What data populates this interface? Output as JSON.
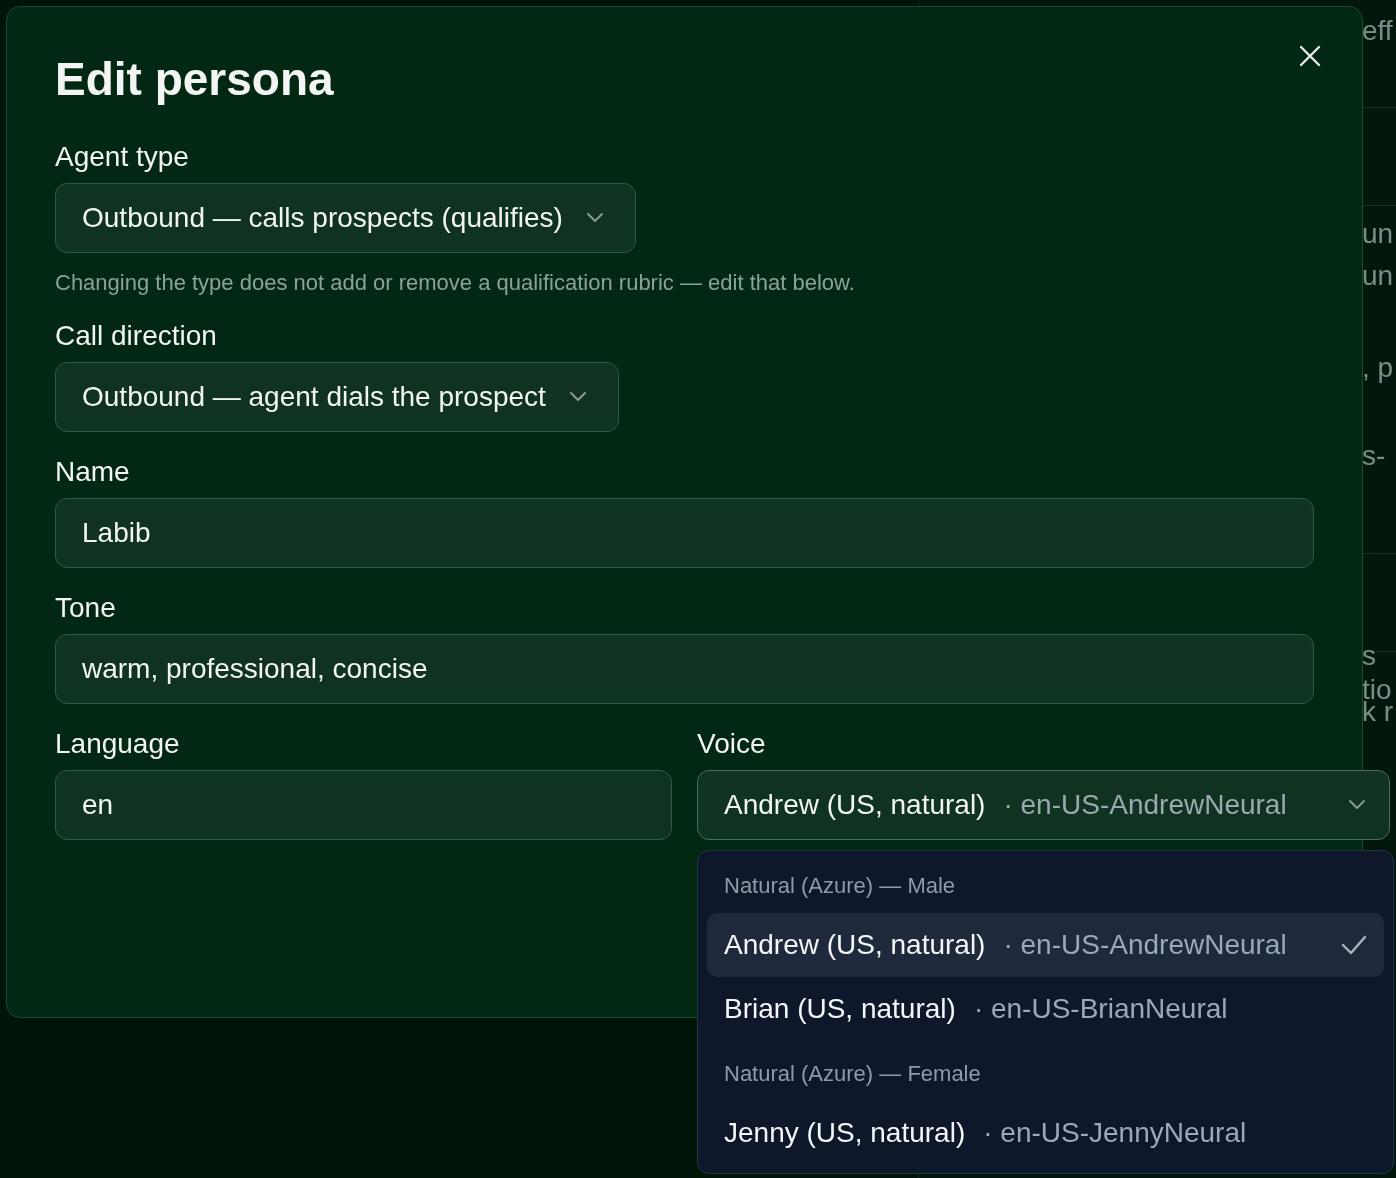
{
  "background_fragments": [
    {
      "text": "eff"
    },
    {
      "text": "un"
    },
    {
      "text": "un"
    },
    {
      "text": ", p"
    },
    {
      "text": "s-"
    },
    {
      "text": "s"
    },
    {
      "text": "tio"
    },
    {
      "text": "k r"
    }
  ],
  "dialog": {
    "title": "Edit persona",
    "fields": [
      {
        "kind": "select",
        "label": "Agent type",
        "value": "Outbound — calls prospects (qualifies)",
        "help": "Changing the type does not add or remove a qualification rubric — edit that below."
      },
      {
        "kind": "select",
        "label": "Call direction",
        "value": "Outbound — agent dials the prospect"
      },
      {
        "kind": "text",
        "label": "Name",
        "value": "Labib"
      },
      {
        "kind": "text",
        "label": "Tone",
        "value": "warm, professional, concise"
      }
    ],
    "row": [
      {
        "kind": "text",
        "label": "Language",
        "value": "en"
      },
      {
        "kind": "select",
        "label": "Voice",
        "value": "Andrew (US, natural)",
        "detail": "· en-US-AndrewNeural",
        "expanded": true
      }
    ]
  },
  "voice_menu": {
    "groups": [
      {
        "heading": "Natural (Azure) — Male",
        "options": [
          {
            "name": "Andrew (US, natural)",
            "detail": "· en-US-AndrewNeural",
            "selected": true
          },
          {
            "name": "Brian (US, natural)",
            "detail": "· en-US-BrianNeural",
            "selected": false
          }
        ]
      },
      {
        "heading": "Natural (Azure) — Female",
        "options": [
          {
            "name": "Jenny (US, natural)",
            "detail": "· en-US-JennyNeural",
            "selected": false
          }
        ]
      }
    ]
  }
}
